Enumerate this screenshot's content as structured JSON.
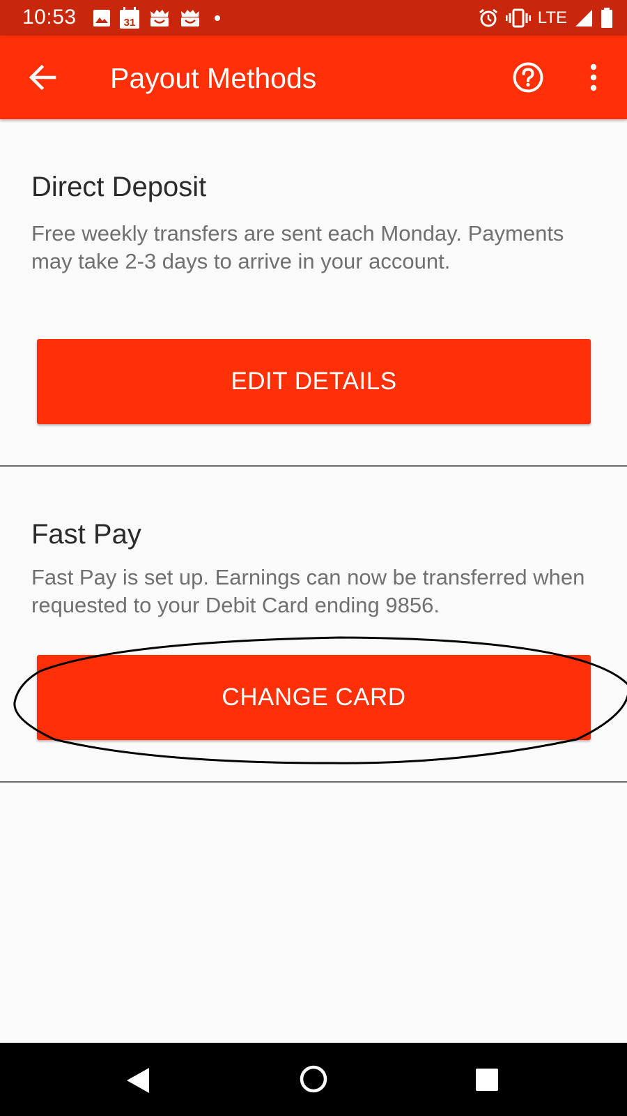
{
  "status_bar": {
    "time": "10:53",
    "calendar_day": "31",
    "network": "LTE",
    "left_icons": [
      "image-icon",
      "calendar-icon",
      "app-notification-icon",
      "app-notification-icon",
      "dot-icon"
    ],
    "right_icons": [
      "alarm-icon",
      "vibrate-icon",
      "signal-icon",
      "battery-icon"
    ]
  },
  "app_bar": {
    "title": "Payout Methods",
    "back_icon": "arrow-back-icon",
    "help_icon": "help-circle-icon",
    "more_icon": "more-vert-icon"
  },
  "direct_deposit": {
    "title": "Direct Deposit",
    "description": "Free weekly transfers are sent each Monday. Payments may take 2-3 days to arrive in your account.",
    "button_label": "EDIT DETAILS"
  },
  "fast_pay": {
    "title": "Fast Pay",
    "description": "Fast Pay is set up. Earnings can now be transferred when requested to your Debit Card ending 9856.",
    "button_label": "CHANGE CARD"
  },
  "nav_bar": {
    "icons": [
      "nav-back-icon",
      "nav-home-icon",
      "nav-recents-icon"
    ]
  },
  "colors": {
    "app_bar": "#ff3008",
    "status_bar": "#c8270b",
    "button": "#ff3008",
    "background": "#fafafa",
    "title_text": "#2b2b2b",
    "body_text": "#707070"
  }
}
